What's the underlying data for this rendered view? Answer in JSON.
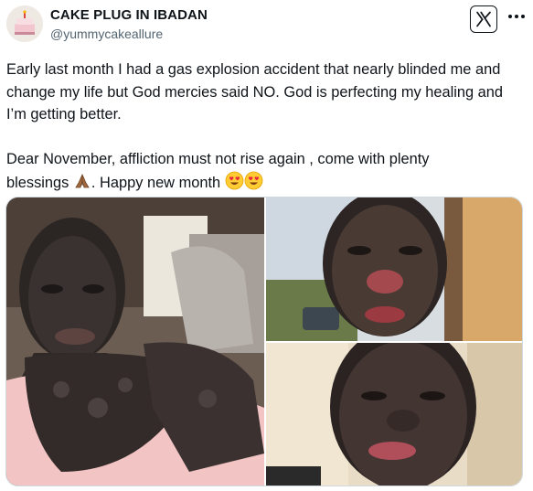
{
  "author": {
    "display_name": "CAKE PLUG IN IBADAN",
    "handle": "@yummycakeallure",
    "avatar_icon": "cake-avatar-icon"
  },
  "header_actions": {
    "platform_icon": "x-logo-icon",
    "more_icon": "more-icon"
  },
  "tweet": {
    "paragraph_1": "Early last month I had a gas explosion accident that nearly blinded me and change my life but God mercies said NO.  God is perfecting my healing and I’m getting better.",
    "paragraph_2_line_1": "Dear November, affliction must not rise again , come with plenty",
    "paragraph_2_line_2_prefix": "blessings",
    "paragraph_2_line_2_middle": ". Happy new month",
    "emojis": [
      "folded-hands-emoji",
      "heart-eyes-emoji",
      "heart-eyes-emoji"
    ]
  },
  "media": {
    "count": 3,
    "photos": [
      "photo-left-large",
      "photo-top-right",
      "photo-bottom-right"
    ]
  },
  "colors": {
    "text": "#0f1419",
    "secondary": "#536471",
    "border": "#cfd9de"
  }
}
